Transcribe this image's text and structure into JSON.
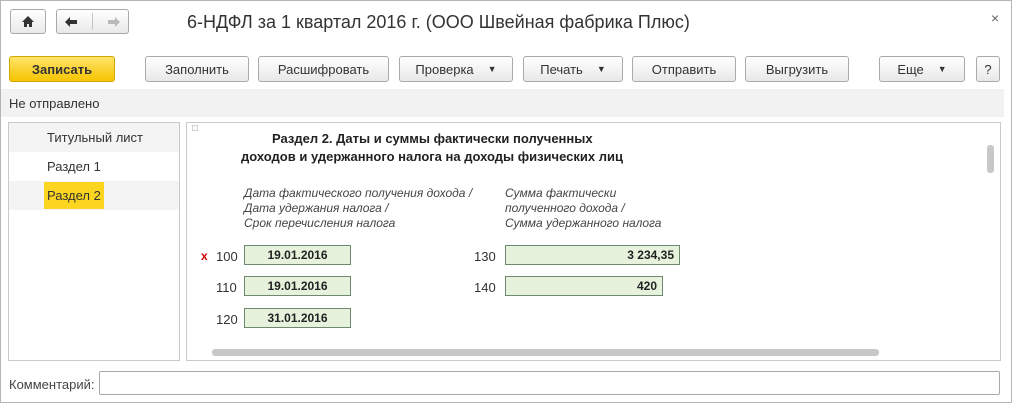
{
  "window": {
    "title": "6-НДФЛ за 1 квартал 2016 г. (ООО Швейная фабрика Плюс)",
    "close_glyph": "×"
  },
  "nav": {
    "home_icon": "home-icon",
    "back_icon": "arrow-left-icon",
    "forward_icon": "arrow-right-icon"
  },
  "toolbar": {
    "save_label": "Записать",
    "fill_label": "Заполнить",
    "decode_label": "Расшифровать",
    "check_label": "Проверка",
    "print_label": "Печать",
    "send_label": "Отправить",
    "export_label": "Выгрузить",
    "more_label": "Еще",
    "help_label": "?"
  },
  "status": {
    "text": "Не отправлено"
  },
  "sidebar": {
    "items": [
      {
        "label": "Титульный лист"
      },
      {
        "label": "Раздел 1"
      },
      {
        "label": "Раздел 2"
      }
    ],
    "selected_index": 2
  },
  "form": {
    "heading_line1": "Раздел 2.  Даты и суммы фактически полученных",
    "heading_line2": "доходов и удержанного налога на доходы физических лиц",
    "left_hint": [
      "Дата фактического получения дохода /",
      "Дата удержания налога /",
      "Срок перечисления налога"
    ],
    "right_hint": [
      "Сумма фактически",
      "полученного дохода /",
      "Сумма удержанного налога"
    ],
    "error_mark": "x",
    "rows": [
      {
        "code": "100",
        "value": "19.01.2016",
        "right_code": "130",
        "right_value": "3 234,35"
      },
      {
        "code": "110",
        "value": "19.01.2016",
        "right_code": "140",
        "right_value": "420"
      },
      {
        "code": "120",
        "value": "31.01.2016"
      }
    ]
  },
  "comment": {
    "label": "Комментарий:",
    "value": ""
  },
  "colors": {
    "primary_button": "#f5c400",
    "selected_item": "#fbd51f",
    "field_bg": "#e7f2dd",
    "error": "#d30000"
  }
}
